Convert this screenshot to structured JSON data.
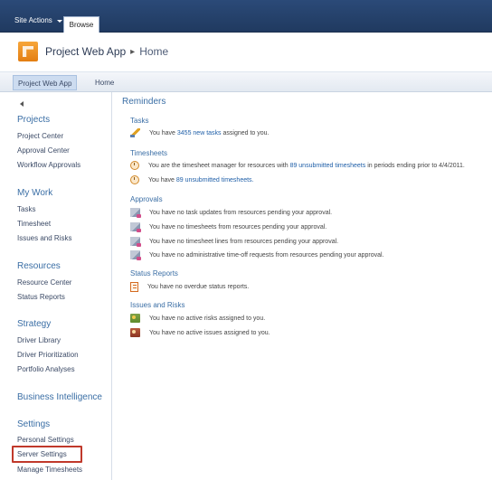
{
  "ribbon": {
    "site_actions_label": "Site Actions",
    "browse_tab_label": "Browse"
  },
  "header": {
    "app_title": "Project Web App",
    "separator": "▸",
    "page_title": "Home"
  },
  "topnav": {
    "items": [
      {
        "label": "Project Web App",
        "active": true
      },
      {
        "label": "Home",
        "active": false
      }
    ]
  },
  "quick_launch": {
    "sections": [
      {
        "heading": "Projects",
        "items": [
          "Project Center",
          "Approval Center",
          "Workflow Approvals"
        ]
      },
      {
        "heading": "My Work",
        "items": [
          "Tasks",
          "Timesheet",
          "Issues and Risks"
        ]
      },
      {
        "heading": "Resources",
        "items": [
          "Resource Center",
          "Status Reports"
        ]
      },
      {
        "heading": "Strategy",
        "items": [
          "Driver Library",
          "Driver Prioritization",
          "Portfolio Analyses"
        ]
      },
      {
        "heading": "Business Intelligence",
        "items": []
      },
      {
        "heading": "Settings",
        "items": [
          "Personal Settings",
          "Server Settings",
          "Manage Timesheets"
        ]
      }
    ],
    "highlighted_item": "Server Settings"
  },
  "reminders": {
    "title": "Reminders",
    "tasks": {
      "heading": "Tasks",
      "row": {
        "pre": "You have",
        "link": "3455 new tasks",
        "post": "assigned to you."
      }
    },
    "timesheets": {
      "heading": "Timesheets",
      "rows": [
        {
          "pre": "You are the timesheet manager for resources with",
          "link": "89 unsubmitted timesheets",
          "post": "in periods ending prior to 4/4/2011."
        },
        {
          "pre": "You have",
          "link": "89 unsubmitted timesheets.",
          "post": ""
        }
      ]
    },
    "approvals": {
      "heading": "Approvals",
      "rows": [
        "You have no task updates from resources pending your approval.",
        "You have no timesheets from resources pending your approval.",
        "You have no timesheet lines from resources pending your approval.",
        "You have no administrative time-off requests from resources pending your approval."
      ]
    },
    "status_reports": {
      "heading": "Status Reports",
      "rows": [
        "You have no overdue status reports."
      ]
    },
    "issues_risks": {
      "heading": "Issues and Risks",
      "rows": [
        "You have no active risks assigned to you.",
        "You have no active issues assigned to you."
      ]
    }
  },
  "icons": {
    "tasks": "pencil-task-icon",
    "timesheets": "clock-timesheet-icon",
    "approvals": "approval-icon",
    "status_reports": "status-report-icon",
    "risks": "risk-icon",
    "issues": "issue-icon"
  },
  "colors": {
    "ribbon": "#203a60",
    "link": "#1f5fa8",
    "heading": "#3a6ea5",
    "highlight_box": "#c0392b"
  }
}
